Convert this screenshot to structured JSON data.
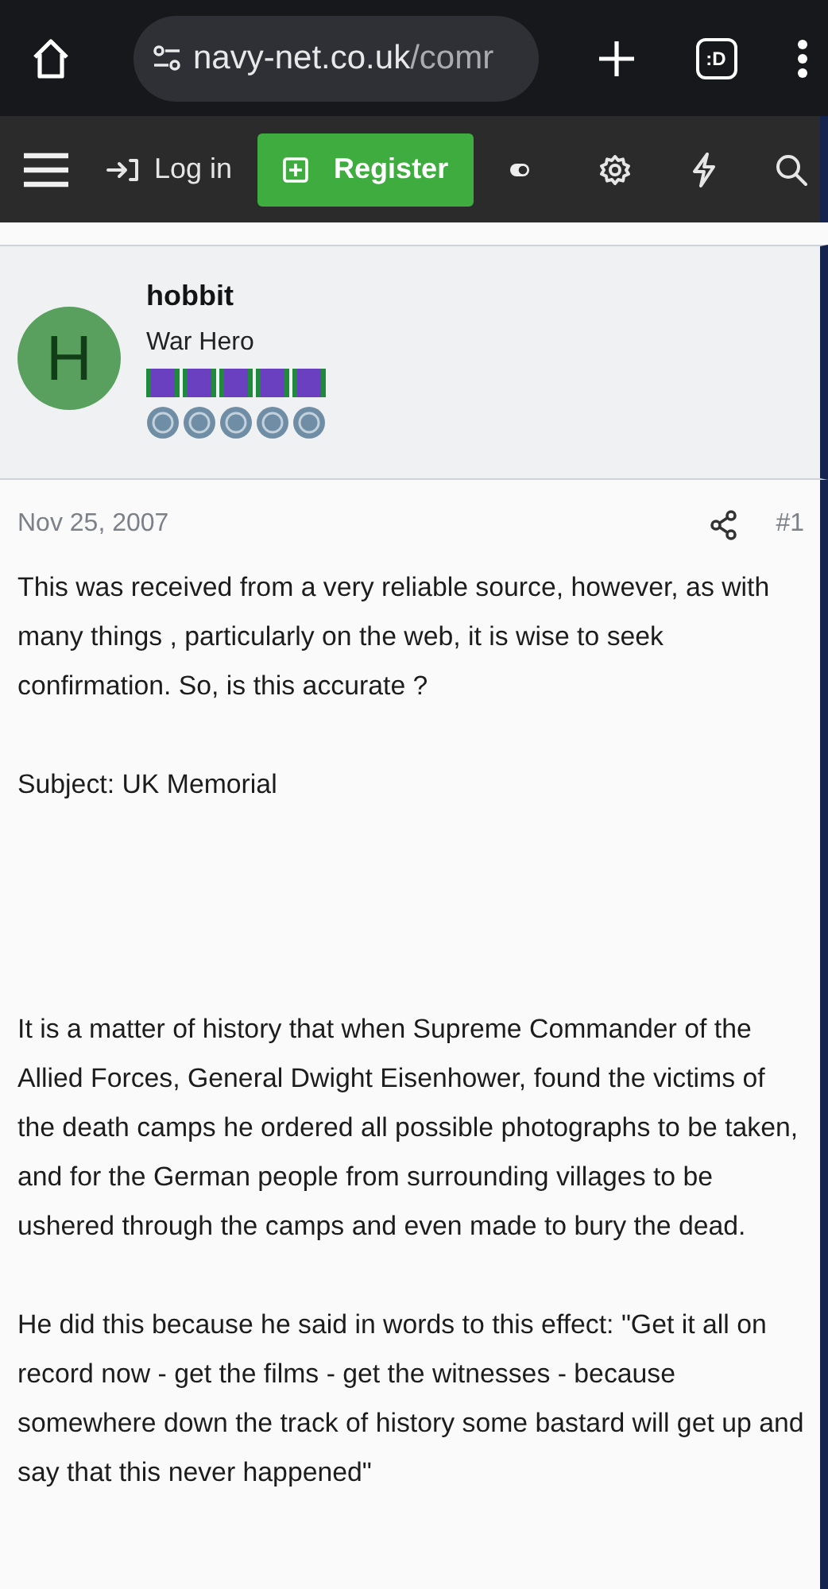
{
  "browser": {
    "url_host": "navy-net.co.uk",
    "url_path": "/comr",
    "tab_count": ":D"
  },
  "navbar": {
    "login": "Log in",
    "register": "Register"
  },
  "post": {
    "avatar_letter": "H",
    "author": "hobbit",
    "rank": "War Hero",
    "date": "Nov 25, 2007",
    "number": "#1",
    "paragraphs": [
      "This was received from a very reliable source, however, as with many things , particularly on the web, it is wise to seek confirmation. So, is this accurate ?",
      "Subject: UK Memorial",
      "It is a matter of history that when Supreme Commander of the Allied Forces, General Dwight Eisenhower, found the victims of the death camps he ordered all possible photographs to be taken, and for the German people from surrounding villages to be ushered through the camps and even made to bury the dead.",
      "He did this because he said in words to this effect: \"Get it all on record now - get the films - get the witnesses - because somewhere down the track of history some bastard will get up and say that this never happened\""
    ]
  }
}
